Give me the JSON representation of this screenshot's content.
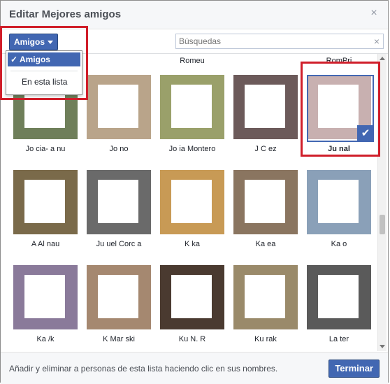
{
  "dialog": {
    "title": "Editar Mejores amigos",
    "close_glyph": "×"
  },
  "toolbar": {
    "filter_label": "Amigos",
    "search_placeholder": "Búsquedas",
    "search_clear_glyph": "×"
  },
  "menu": {
    "items": [
      {
        "label": "✓ Amigos",
        "selected": true
      },
      {
        "label": "En esta lista",
        "selected": false
      }
    ]
  },
  "top_labels": [
    "Romeu",
    "RomPri"
  ],
  "rows": [
    {
      "tiles": [
        {
          "name": "Jo          cia- a            nu",
          "color": "#6f7f5a"
        },
        {
          "name": "Jo                    no",
          "color": "#b9a48a"
        },
        {
          "name": "Jo           ia Montero",
          "color": "#9aa06a"
        },
        {
          "name": "J                C           ez",
          "color": "#6c5a5a"
        },
        {
          "name": "Ju          nal",
          "color": "#c8b0b0",
          "selected": true
        }
      ]
    },
    {
      "tiles": [
        {
          "name": "A            Al           nau",
          "color": "#7a6a4a"
        },
        {
          "name": "Ju          uel Corc           a",
          "color": "#6a6a6a"
        },
        {
          "name": "K         ka",
          "color": "#c89a55"
        },
        {
          "name": "Ka            ea",
          "color": "#8a7560"
        },
        {
          "name": "Ka                o",
          "color": "#8aa0b8"
        }
      ]
    },
    {
      "tiles": [
        {
          "name": "Ka                /k",
          "color": "#8a7a9a"
        },
        {
          "name": "K           Mar         ski",
          "color": "#a58870"
        },
        {
          "name": "Ku          N. R",
          "color": "#4a3a30"
        },
        {
          "name": "Ku          rak",
          "color": "#9a8a6a"
        },
        {
          "name": "La             ter",
          "color": "#5a5a5a"
        }
      ]
    }
  ],
  "footer": {
    "info": "Añadir y eliminar a personas de esta lista haciendo clic en sus nombres.",
    "done_label": "Terminar"
  },
  "colors": {
    "accent": "#4267b2",
    "highlight": "#d01e2a"
  }
}
